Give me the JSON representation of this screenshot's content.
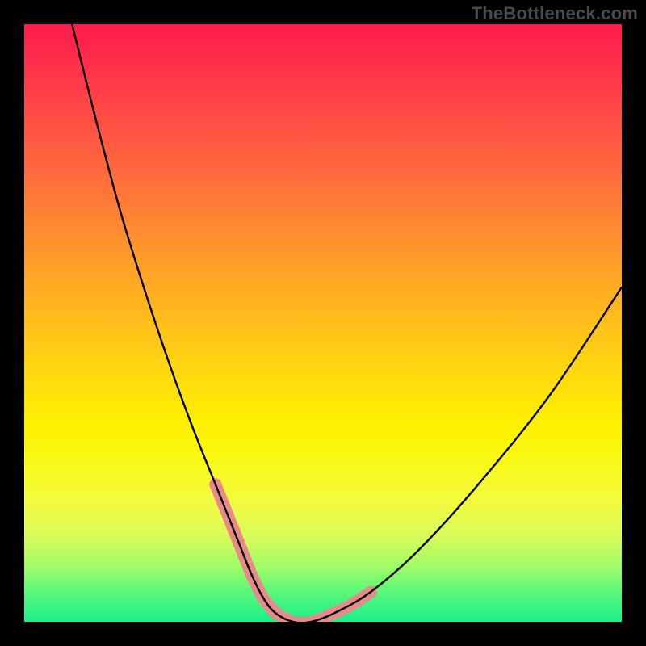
{
  "watermark": "TheBottleneck.com",
  "chart_data": {
    "type": "line",
    "title": "",
    "xlabel": "",
    "ylabel": "",
    "xlim": [
      0,
      100
    ],
    "ylim": [
      0,
      100
    ],
    "series": [
      {
        "name": "curve",
        "x": [
          8,
          12,
          16,
          20,
          24,
          28,
          32,
          34,
          36,
          38,
          40,
          42,
          45,
          48,
          52,
          58,
          66,
          76,
          88,
          100
        ],
        "y": [
          100,
          84,
          69,
          56,
          44,
          33,
          23,
          18,
          13,
          8,
          4,
          1.5,
          0,
          0,
          1.5,
          5,
          12,
          23,
          38,
          56
        ]
      }
    ],
    "highlights": [
      {
        "name": "left-highlight",
        "x": [
          32,
          34,
          36,
          38,
          40,
          42
        ],
        "y": [
          23,
          18,
          13,
          8,
          4,
          1.5
        ]
      },
      {
        "name": "bottom-highlight",
        "x": [
          42,
          45,
          48,
          52
        ],
        "y": [
          1.5,
          0,
          0,
          1.5
        ]
      },
      {
        "name": "right-highlight",
        "x": [
          52,
          55,
          58
        ],
        "y": [
          1.5,
          3,
          5
        ]
      }
    ],
    "colors": {
      "curve": "#000000",
      "highlight": "#e98a8a",
      "background_top": "#ff1a4d",
      "background_bottom": "#1af08a",
      "frame": "#000000"
    }
  }
}
